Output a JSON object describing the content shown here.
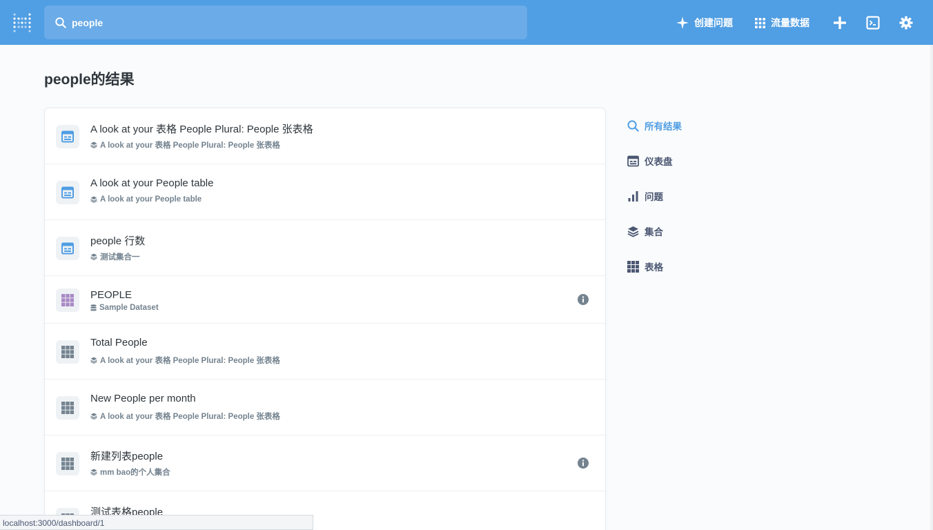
{
  "colors": {
    "nav_bg": "#509ee3",
    "search_bg": "#6aabe8",
    "accent": "#509ee3",
    "text_dark": "#2e353b",
    "text_muted": "#74838f",
    "dashboard_icon": "#509ee3",
    "table_icon_purple": "#a989c5",
    "table_icon_gray": "#74838f"
  },
  "header": {
    "logo_icon": "metabase-logo-icon",
    "search": {
      "value": "people",
      "icon": "search-icon"
    },
    "new_question": {
      "label": "创建问题",
      "icon": "sparkle-icon"
    },
    "browse_data": {
      "label": "流量数据",
      "icon": "grid-icon"
    },
    "add_icon": "plus-icon",
    "sql_icon": "sql-editor-icon",
    "settings_icon": "gear-icon"
  },
  "page_title": "people的结果",
  "results": [
    {
      "title": "A look at your 表格 People Plural: People 张表格",
      "subtitle": "A look at your 表格 People Plural: People 张表格",
      "type": "dashboard",
      "sub_icon": "collection-icon",
      "info": false
    },
    {
      "title": "A look at your People table",
      "subtitle": "A look at your People table",
      "type": "dashboard",
      "sub_icon": "collection-icon",
      "info": false
    },
    {
      "title": "people 行数",
      "subtitle": "测试集合一",
      "type": "dashboard",
      "sub_icon": "collection-icon",
      "info": false
    },
    {
      "title": "PEOPLE",
      "subtitle": "Sample Dataset",
      "type": "table-purple",
      "sub_icon": "database-icon",
      "info": true
    },
    {
      "title": "Total People",
      "subtitle": "A look at your 表格 People Plural: People 张表格",
      "type": "table",
      "sub_icon": "collection-icon",
      "info": false
    },
    {
      "title": "New People per month",
      "subtitle": "A look at your 表格 People Plural: People 张表格",
      "type": "table",
      "sub_icon": "collection-icon",
      "info": false
    },
    {
      "title": "新建列表people",
      "subtitle": "mm bao的个人集合",
      "type": "table",
      "sub_icon": "collection-icon",
      "info": true
    },
    {
      "title": "测试表格people",
      "subtitle": "",
      "type": "table",
      "sub_icon": "collection-icon",
      "info": false
    }
  ],
  "filters": [
    {
      "label": "所有结果",
      "icon": "search-icon",
      "active": true
    },
    {
      "label": "仪表盘",
      "icon": "dashboard-icon",
      "active": false
    },
    {
      "label": "问题",
      "icon": "bar-chart-icon",
      "active": false
    },
    {
      "label": "集合",
      "icon": "collection-icon",
      "active": false
    },
    {
      "label": "表格",
      "icon": "table-icon",
      "active": false
    }
  ],
  "status_url": "localhost:3000/dashboard/1"
}
